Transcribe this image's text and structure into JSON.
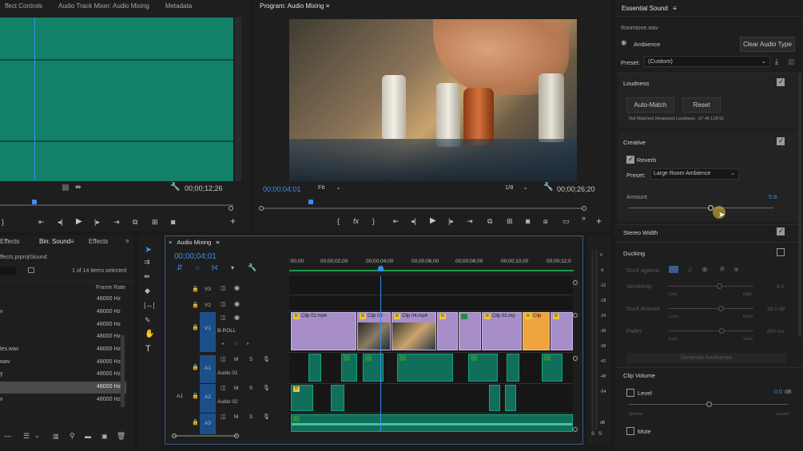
{
  "source_panel": {
    "tabs": [
      "ffect Controls",
      "Audio Track Mixer: Audio Mixing",
      "Metadata"
    ],
    "timecode": "00;00;12;26"
  },
  "program_panel": {
    "title": "Program: Audio Mixing",
    "timecode": "00;00;04;01",
    "fit": "Fit",
    "resolution": "1/8",
    "duration": "00;00;26;20"
  },
  "essential_sound": {
    "title": "Essential Sound",
    "clip_name": "Roomtone.wav",
    "type_label": "Ambience",
    "clear_button": "Clear Audio Type",
    "preset_label": "Preset:",
    "preset_value": "(Custom)",
    "loudness": {
      "label": "Loudness",
      "auto_match": "Auto-Match",
      "reset": "Reset",
      "status": "Not Matched (Analyzed Loudness: -37.46 LUFS)"
    },
    "creative": {
      "label": "Creative",
      "reverb": "Reverb",
      "preset_label": "Preset:",
      "preset_value": "Large Room Ambience",
      "amount_label": "Amount",
      "amount_value": "5.6",
      "amount_fraction": 0.56
    },
    "stereo_width": "Stereo Width",
    "ducking": {
      "label": "Ducking",
      "duck_against": "Duck against:",
      "sensitivity": "Sensitivity",
      "sens_low": "Low",
      "sens_high": "High",
      "sens_value": "6.0",
      "duck_amount": "Duck Amount",
      "amt_low": "Less",
      "amt_high": "More",
      "amt_value": "-18.0 dB",
      "fades": "Fades",
      "fade_low": "Fast",
      "fade_high": "Slow",
      "fade_value": "800 ms",
      "generate": "Generate Keyframes"
    },
    "clip_volume": {
      "label": "Clip Volume",
      "level": "Level",
      "level_value": "0.0",
      "level_unit": "dB",
      "quieter": "Quieter",
      "louder": "Louder",
      "mute": "Mute"
    }
  },
  "project_panel": {
    "tabs": [
      "Effects",
      "Bin: Sound",
      "Effects"
    ],
    "path": "ffects.prproj\\Sound",
    "count": "1 of 14 items selected",
    "col_frame_rate": "Frame Rate",
    "rows": [
      {
        "name": "",
        "rate": "48000 Hz"
      },
      {
        "name": "v",
        "rate": "48000 Hz"
      },
      {
        "name": "",
        "rate": "48000 Hz"
      },
      {
        "name": "",
        "rate": "48000 Hz"
      },
      {
        "name": "les.wav",
        "rate": "48000 Hz"
      },
      {
        "name": "wav",
        "rate": "48000 Hz"
      },
      {
        "name": "y",
        "rate": "48000 Hz"
      },
      {
        "name": "",
        "rate": "48000 Hz"
      },
      {
        "name": "v",
        "rate": "48000 Hz"
      }
    ]
  },
  "timeline": {
    "title": "Audio Mixing",
    "timecode": "00;00;04;01",
    "ruler": [
      ":00;00",
      "00;00;02;00",
      "00;00;04;00",
      "00;00;06;00",
      "00;00;08;00",
      "00;00;10;00",
      "00;00;12;0"
    ],
    "tracks": {
      "v3": "V3",
      "v2": "V2",
      "v1": "V1",
      "v1_name": "B-ROLL",
      "a1": "A1",
      "a1_name": "Audio 01",
      "a2": "A2",
      "a2_name": "Audio 02",
      "a2_src": "A1",
      "a3": "A3"
    },
    "clips": [
      "Clip 01.mp4",
      "Clip 03",
      "Clip 04.mp4",
      "Clip 02.mp",
      "Clip"
    ]
  },
  "meter": {
    "ticks": [
      "0",
      "-6",
      "-12",
      "-18",
      "-24",
      "-30",
      "-36",
      "-42",
      "-48",
      "-54",
      "dB"
    ]
  }
}
